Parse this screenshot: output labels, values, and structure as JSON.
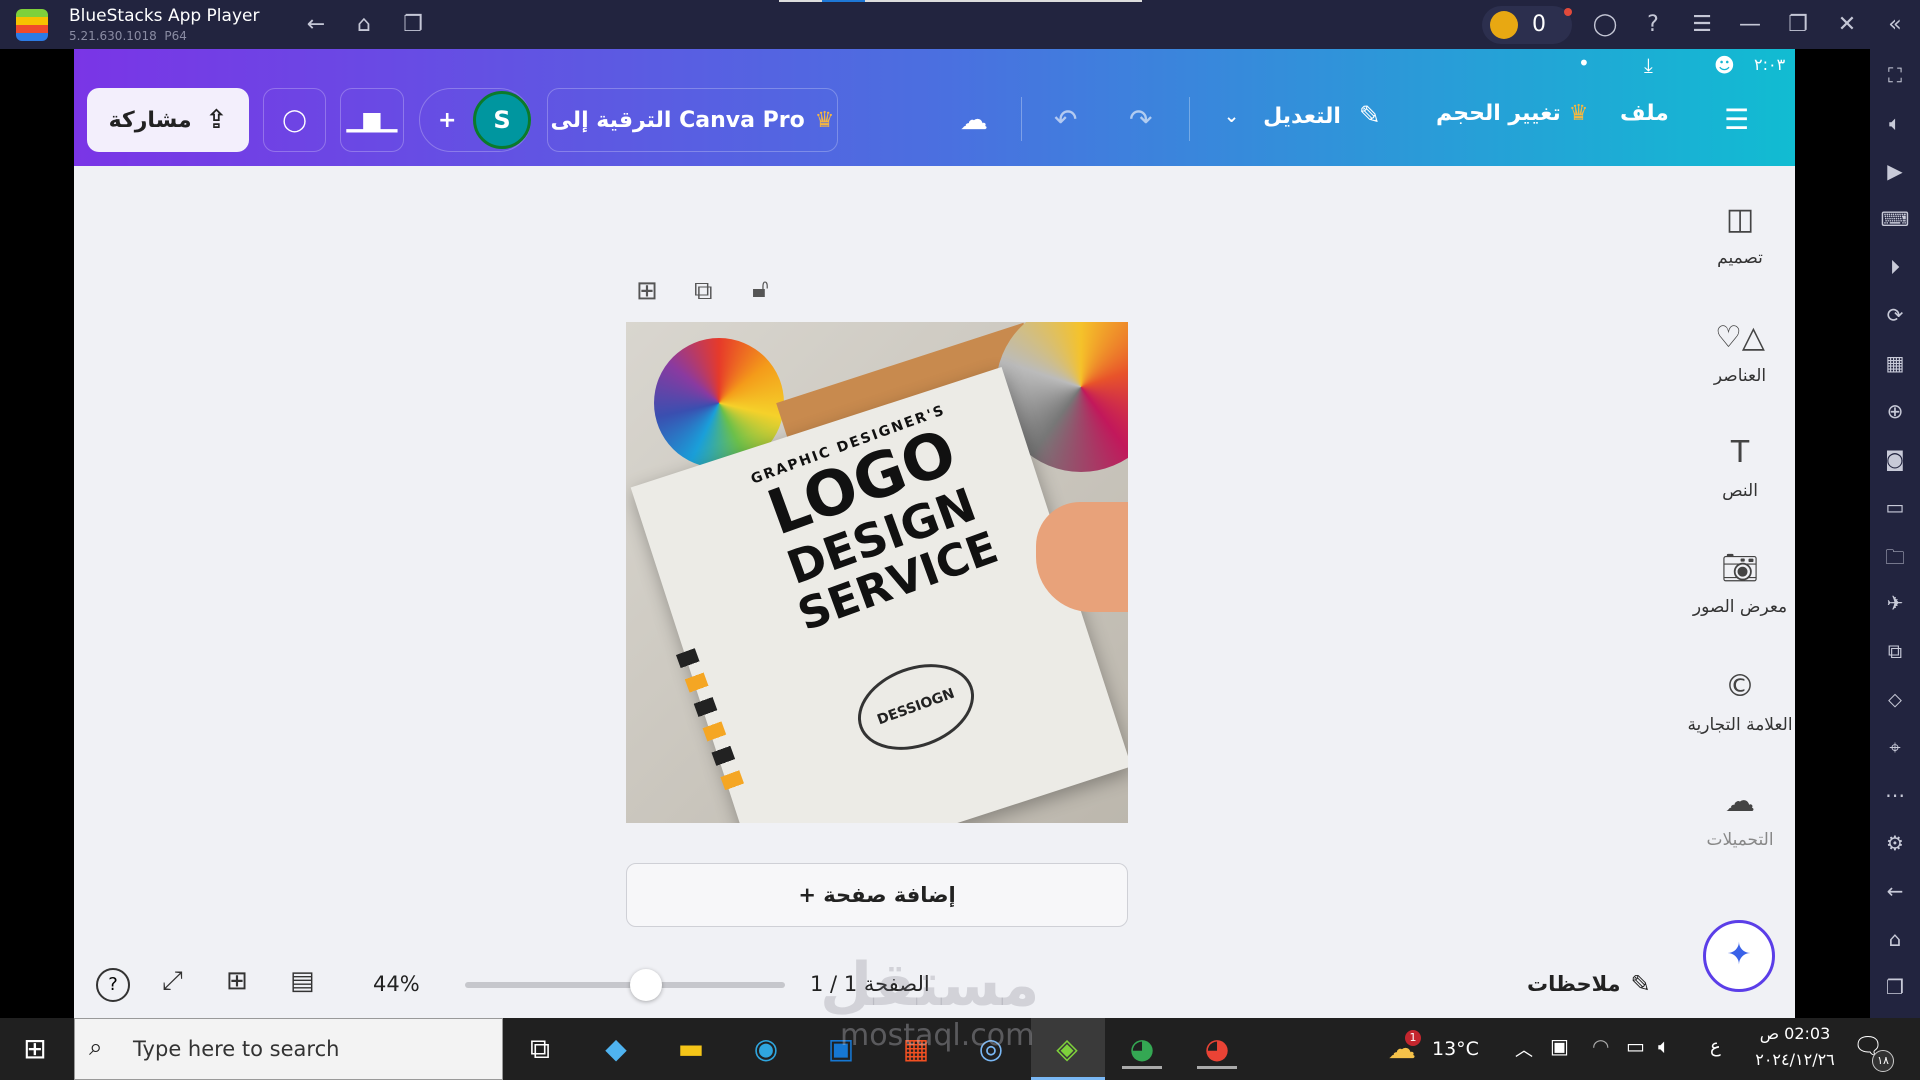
{
  "window": {
    "title": "BlueStacks App Player",
    "version": "5.21.630.1018  P64",
    "coins": "0"
  },
  "status_bar": {
    "time": "٢:٠٣"
  },
  "header": {
    "share_label": "مشاركة",
    "avatar_initial": "S",
    "upgrade_label": "الترقية إلى Canva Pro",
    "edit_label": "التعديل",
    "resize_label": "تغيير الحجم",
    "file_label": "ملف"
  },
  "side_panel": {
    "items": [
      {
        "label": "تصميم",
        "icon": "layout-icon"
      },
      {
        "label": "العناصر",
        "icon": "shapes-icon"
      },
      {
        "label": "النص",
        "icon": "text-icon"
      },
      {
        "label": "معرض الصور",
        "icon": "camera-icon"
      },
      {
        "label": "العلامة التجارية",
        "icon": "brand-icon"
      },
      {
        "label": "التحميلات",
        "icon": "upload-cloud-icon"
      }
    ]
  },
  "design": {
    "image_text": {
      "line1": "GRAPHIC DESIGNER'S",
      "line2": "LOGO",
      "line3": "DESIGN",
      "line4": "SERVICE",
      "stamp": "DESSIOGN"
    }
  },
  "add_page_label": "+ إضافة صفحة",
  "bottom_bar": {
    "notes_label": "ملاحظات",
    "page_label": "الصفحة 1 / 1",
    "zoom_label": "44%",
    "zoom_value": 44
  },
  "watermark": {
    "text": "مستقل",
    "sub": "mostaql.com"
  },
  "taskbar": {
    "search_placeholder": "Type here to search",
    "temperature": "13°C",
    "weather_badge": "1",
    "lang": "ع",
    "time": "02:03 ص",
    "date": "٢٠٢٤/١٢/٢٦",
    "notif_count": "١٨"
  },
  "colors": {
    "titlebar": "#22243f",
    "header_start": "#7a35e6",
    "header_end": "#11bcd2",
    "canvas_bg": "#f0f1f5",
    "avatar": "#00969f",
    "magic": "#5b3ee8"
  }
}
